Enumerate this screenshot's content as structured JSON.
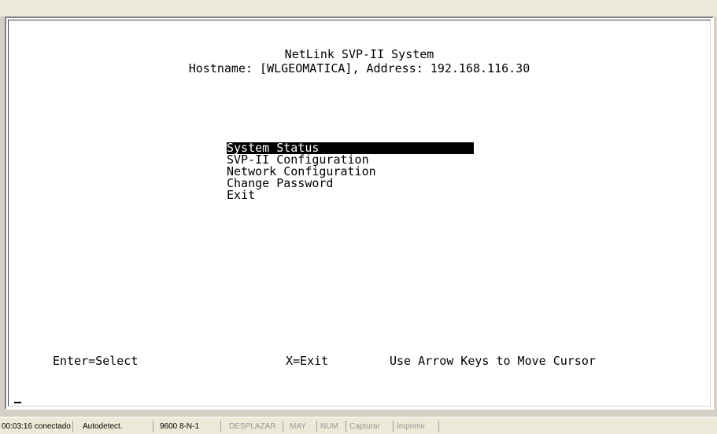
{
  "terminal": {
    "title": "NetLink SVP-II System",
    "host_line": "Hostname: [WLGEOMATICA], Address: 192.168.116.30",
    "menu": [
      {
        "label": "System Status",
        "selected": true
      },
      {
        "label": "SVP-II Configuration",
        "selected": false
      },
      {
        "label": "Network Configuration",
        "selected": false
      },
      {
        "label": "Change Password",
        "selected": false
      },
      {
        "label": "Exit",
        "selected": false
      }
    ],
    "footer": {
      "enter_hint": "Enter=Select",
      "exit_hint": "X=Exit",
      "arrow_hint": "Use Arrow Keys to Move Cursor"
    }
  },
  "statusbar": {
    "connection": "00:03:16 conectado",
    "detect": "Autodetect.",
    "serial": "9600 8-N-1",
    "scroll": "DESPLAZAR",
    "caps": "MAY",
    "num": "NUM",
    "capture": "Capturar",
    "print": "Imprimir"
  }
}
